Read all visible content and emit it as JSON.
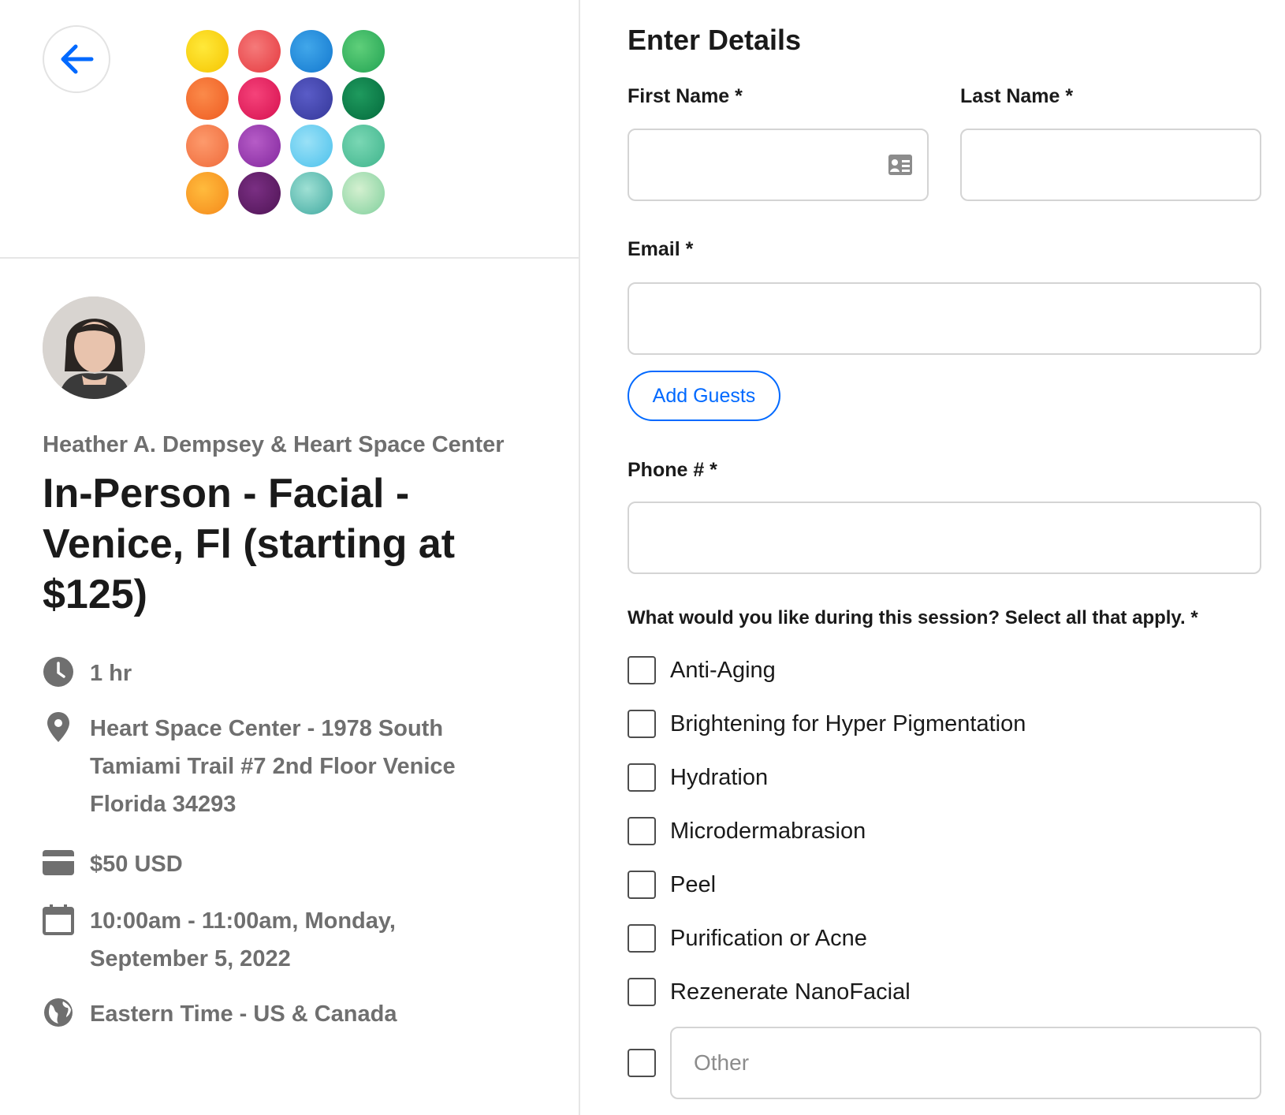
{
  "left": {
    "back_icon": "arrow-left-icon",
    "logo": "watercolor-dots-logo",
    "organizer": "Heather A. Dempsey & Heart Space Center",
    "event_title": "In-Person - Facial - Venice, Fl (starting at $125)",
    "details": {
      "duration": "1 hr",
      "location": "Heart Space Center - 1978 South Tamiami Trail #7 2nd Floor Venice Florida 34293",
      "price": "$50 USD",
      "datetime": "10:00am - 11:00am, Monday, September 5, 2022",
      "timezone": "Eastern Time - US & Canada"
    }
  },
  "form": {
    "heading": "Enter Details",
    "first_name_label": "First Name *",
    "first_name_value": "",
    "last_name_label": "Last Name *",
    "last_name_value": "",
    "email_label": "Email *",
    "email_value": "",
    "add_guests_label": "Add Guests",
    "phone_label": "Phone # *",
    "phone_value": "",
    "question": "What would you like during this session? Select all that apply. *",
    "options": [
      "Anti-Aging",
      "Brightening for Hyper Pigmentation",
      "Hydration",
      "Microdermabrasion",
      "Peel",
      "Purification or Acne",
      "Rezenerate NanoFacial"
    ],
    "other_placeholder": "Other"
  },
  "colors": {
    "accent": "#0069ff",
    "muted_text": "#6f6f6f",
    "border": "#d4d4d4"
  }
}
